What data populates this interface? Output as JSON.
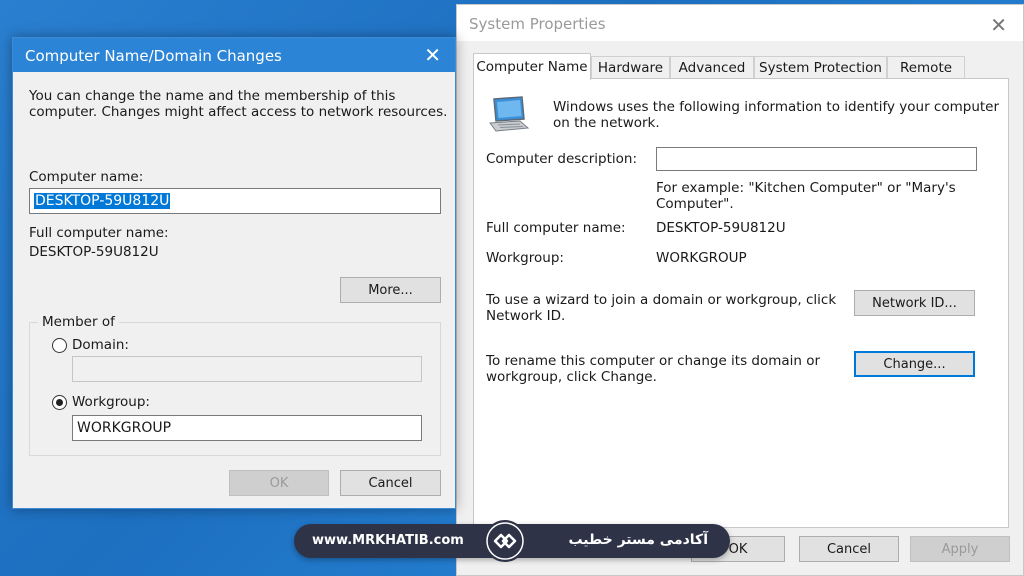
{
  "system_properties": {
    "title": "System Properties",
    "tabs": [
      "Computer Name",
      "Hardware",
      "Advanced",
      "System Protection",
      "Remote"
    ],
    "intro_line1": "Windows uses the following information to identify your computer",
    "intro_line2": "on the network.",
    "description_label": "Computer description:",
    "description_value": "",
    "example_line1": "For example: \"Kitchen Computer\" or \"Mary's",
    "example_line2": "Computer\".",
    "full_name_label": "Full computer name:",
    "full_name_value": "DESKTOP-59U812U",
    "workgroup_label": "Workgroup:",
    "workgroup_value": "WORKGROUP",
    "wizard_line1": "To use a wizard to join a domain or workgroup, click",
    "wizard_line2": "Network ID.",
    "network_id_button": "Network ID...",
    "rename_line1": "To rename this computer or change its domain or",
    "rename_line2": "workgroup, click Change.",
    "change_button": "Change...",
    "ok_button": "OK",
    "cancel_button": "Cancel",
    "apply_button": "Apply"
  },
  "name_changes": {
    "title": "Computer Name/Domain Changes",
    "intro_line1": "You can change the name and the membership of this",
    "intro_line2": "computer. Changes might affect access to network resources.",
    "computer_name_label": "Computer name:",
    "computer_name_value": "DESKTOP-59U812U",
    "full_name_label": "Full computer name:",
    "full_name_value": "DESKTOP-59U812U",
    "more_button": "More...",
    "member_of_label": "Member of",
    "domain_label": "Domain:",
    "domain_value": "",
    "workgroup_label": "Workgroup:",
    "workgroup_value": "WORKGROUP",
    "member_selected": "Workgroup",
    "ok_button": "OK",
    "cancel_button": "Cancel"
  },
  "watermark": {
    "url": "www.MRKHATIB.com",
    "brand": "آکادمی مستر خطیب"
  },
  "colors": {
    "desktop": "#1d6fc0",
    "accent": "#0078d7",
    "dialog_bg": "#f0f0f0",
    "watermark_bg": "#2e3347"
  }
}
